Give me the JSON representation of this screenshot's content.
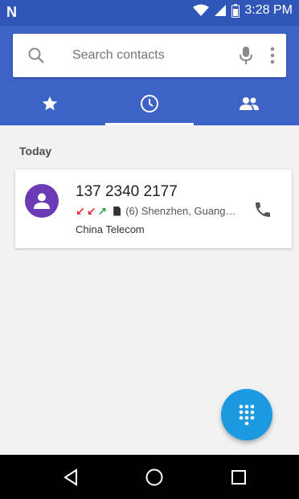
{
  "status_bar": {
    "time": "3:28 PM",
    "notification_logo": "N"
  },
  "search": {
    "placeholder": "Search contacts"
  },
  "tabs": [
    {
      "icon": "star-icon",
      "label": "Favorites"
    },
    {
      "icon": "clock-icon",
      "label": "Recents",
      "active": true
    },
    {
      "icon": "people-icon",
      "label": "Contacts"
    }
  ],
  "recents": {
    "section_title": "Today",
    "items": [
      {
        "number": "137 2340 2177",
        "call_icons": [
          "↙",
          "↙",
          "↗"
        ],
        "location": "(6) Shenzhen, Guang…",
        "carrier": "China Telecom"
      }
    ]
  },
  "colors": {
    "primary": "#3d63c7",
    "status_bar": "#2f56b8",
    "avatar": "#6b3bb5",
    "fab": "#1b9ae2"
  }
}
